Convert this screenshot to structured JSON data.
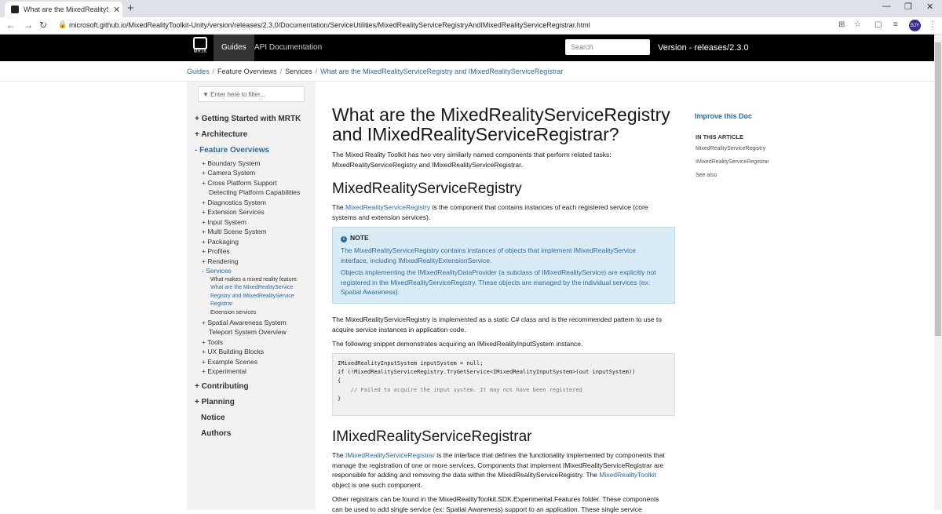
{
  "browser": {
    "tab_title": "What are the MixedRealityServic",
    "url": "microsoft.github.io/MixedRealityToolkit-Unity/version/releases/2.3.0/Documentation/ServiceUtilities/MixedRealityServiceRegistryAndIMixedRealityServiceRegistrar.html",
    "avatar_text": "BJY"
  },
  "header": {
    "logo_text": "MRTK",
    "nav": [
      "Guides",
      "API Documentation"
    ],
    "search_placeholder": "Search",
    "version": "Version - releases/2.3.0"
  },
  "breadcrumb": [
    "Guides",
    "Feature Overviews",
    "Services",
    "What are the MixedRealityServiceRegistry and IMixedRealityServiceRegistrar"
  ],
  "sidebar": {
    "filter_placeholder": "Enter here to filter...",
    "top_items": [
      {
        "label": "+ Getting Started with MRTK"
      },
      {
        "label": "+ Architecture"
      },
      {
        "label": "- Feature Overviews"
      },
      {
        "label": "+ Contributing"
      },
      {
        "label": "+ Planning"
      },
      {
        "label": "Notice"
      },
      {
        "label": "Authors"
      }
    ],
    "sub_items": [
      "+  Boundary System",
      "+  Camera System",
      "+  Cross Platform Support",
      "Detecting Platform Capabilities",
      "+  Diagnostics System",
      "+  Extension Services",
      "+  Input System",
      "+  Multi Scene System",
      "+  Packaging",
      "+  Profiles",
      "+  Rendering",
      "-  Services",
      "+  Spatial Awareness System",
      "Teleport System Overview",
      "+  Tools",
      "+  UX Building Blocks",
      "+  Example Scenes",
      "+  Experimental"
    ],
    "services_children": [
      "What makes a mixed reality feature",
      "What are the MixedRealityService",
      "Registry and IMixedRealityService",
      "Registrar",
      "Extension services"
    ]
  },
  "article": {
    "title_line1": "What are the MixedRealityServiceRegistry",
    "title_line2": "and IMixedRealityServiceRegistrar?",
    "intro_1": "The Mixed Reality Toolkit has two very similarly named components that perform related tasks:",
    "intro_2": "MixedRealityServiceRegistry and IMixedRealityServiceRegistrar.",
    "h2_registry": "MixedRealityServiceRegistry",
    "reg_p1_pre": "The ",
    "reg_p1_link": "MixedRealityServiceRegistry",
    "reg_p1_post": " is the component that contains instances of each registered service (core",
    "reg_p1_line2": "systems and extension services).",
    "note_title": "NOTE",
    "note_p1a": "The MixedRealityServiceRegistry contains instances of objects that implement IMixedRealityService",
    "note_p1b": "interface, including IMixedRealityExtensionService.",
    "note_p2a": "Objects implementing the IMixedRealityDataProvider (a subclass of IMixedRealityService) are explicitly not",
    "note_p2b": "registered in the MixedRealityServiceRegistry. These objects are managed by the individual services (ex:",
    "note_p2c": "Spatial Awareness).",
    "reg_p2a": "The MixedRealityServiceRegistry is implemented as a static C# class and is the recommended pattern to use to",
    "reg_p2b": "acquire service instances in application code.",
    "reg_p3": "The following snippet demonstrates acquiring an IMixedRealityInputSystem instance.",
    "code_l1": "IMixedRealityInputSystem inputSystem = null;",
    "code_l2": "",
    "code_l3": "if (!MixedRealityServiceRegistry.TryGetService<IMixedRealityInputSystem>(out inputSystem))",
    "code_l4": "{",
    "code_l5": "    // Failed to acquire the input system. It may not have been registered",
    "code_l6": "}",
    "h2_registrar": "IMixedRealityServiceRegistrar",
    "rar_p1_pre": "The ",
    "rar_p1_link": "IMixedRealityServiceRegistrar",
    "rar_p1_post": " is the interface that defines the functionality implemented by components that",
    "rar_p1_l2": "manage the registration of one or more services. Components that implement IMixedRealityServiceRegistrar are",
    "rar_p1_l3_pre": "responsible for adding and removing the data within the MixedRealityServiceRegistry. The ",
    "rar_p1_l3_link": "MixedRealityToolkit",
    "rar_p1_l4": "object is one such component.",
    "rar_p2a": "Other registrars can be found in the MixedRealityToolkit.SDK.Experimental.Features folder. These components",
    "rar_p2b": "can be used to add single service (ex: Spatial Awareness) support to an application. These single service"
  },
  "right_rail": {
    "improve": "Improve this Doc",
    "in_this_article": "IN THIS ARTICLE",
    "links": [
      "MixedRealityServiceRegistry",
      "IMixedRealityServiceRegistrar",
      "See also"
    ]
  }
}
